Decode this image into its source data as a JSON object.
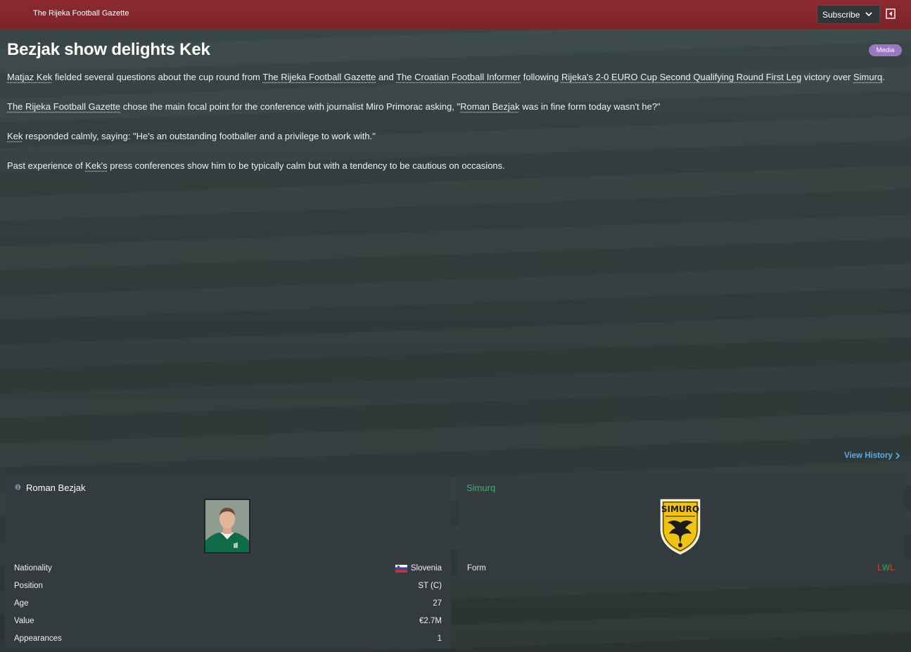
{
  "header": {
    "title": "The Rijeka Football Gazette",
    "subscribe_label": "Subscribe"
  },
  "article": {
    "title": "Bezjak show delights Kek",
    "tag": "Media",
    "p1": {
      "link1": "Matjaz Kek",
      "t1": " fielded several questions about the cup round from ",
      "link2": "The Rijeka Football Gazette",
      "t2": " and ",
      "link3": "The Croatian Football Informer",
      "t3": " following ",
      "link4": "Rijeka's 2-0 EURO Cup Second Qualifying Round First Leg",
      "t4": " victory over ",
      "link5": "Simurq",
      "t5": "."
    },
    "p2": {
      "link1": "The Rijeka Football Gazette",
      "t1": " chose the main focal point for the conference with journalist Miro Primorac asking, \"",
      "link2": "Roman Bezjak",
      "t2": " was in fine form today wasn't he?\""
    },
    "p3": {
      "link1": "Kek",
      "t1": " responded calmly, saying: \"He's an outstanding footballer and a privilege to work with.\""
    },
    "p4": {
      "t0": "Past experience of ",
      "link1": "Kek's",
      "t1": " press conferences show him to be typically calm but with a tendency to be cautious on occasions."
    }
  },
  "view_history_label": "View History",
  "player_card": {
    "name": "Roman Bezjak",
    "rows": [
      {
        "label": "Nationality",
        "value": "Slovenia"
      },
      {
        "label": "Position",
        "value": "ST (C)"
      },
      {
        "label": "Age",
        "value": "27"
      },
      {
        "label": "Value",
        "value": "€2.7M"
      },
      {
        "label": "Appearances",
        "value": "1"
      }
    ]
  },
  "club_card": {
    "name": "Simurq",
    "crest_text": "SIMURQ",
    "form_label": "Form",
    "form": [
      "L",
      "W",
      "L"
    ]
  },
  "colors": {
    "header": "#8c2a30",
    "accent_link": "#5fa8e6",
    "club_name": "#3fae72",
    "tag": "#9b76c4",
    "form_loss": "#c0392b",
    "form_win": "#3a8a4a"
  }
}
